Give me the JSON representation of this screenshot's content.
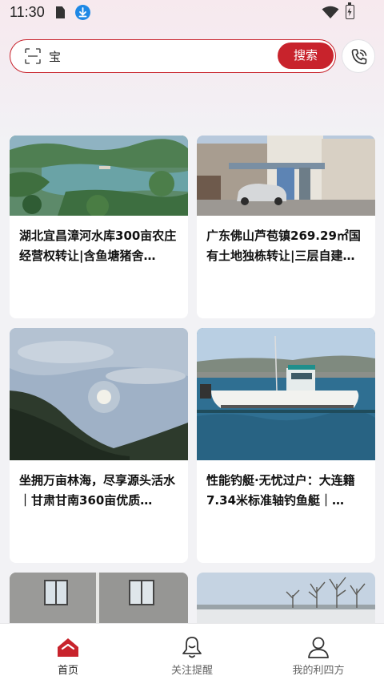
{
  "status_bar": {
    "time": "11:30"
  },
  "search": {
    "query": "宝",
    "button_label": "搜索"
  },
  "colors": {
    "accent": "#c8232c"
  },
  "feed": [
    {
      "title": "湖北宜昌漳河水库300亩农庄经营权转让|含鱼塘猪舍…",
      "image": "lake-reservoir-aerial"
    },
    {
      "title": "广东佛山芦苞镇269.29㎡国有土地独栋转让|三层自建…",
      "image": "street-house-with-car"
    },
    {
      "title": "坐拥万亩林海，尽享源头活水｜甘肃甘南360亩优质…",
      "image": "forest-hills-sunset"
    },
    {
      "title": "性能钓艇·无忧过户：大连籍7.34米标准轴钓鱼艇｜…",
      "image": "fishing-boat-harbor"
    },
    {
      "title": "",
      "image": "empty-room-interior"
    },
    {
      "title": "",
      "image": "winter-field-trees"
    }
  ],
  "bottom_nav": [
    {
      "label": "首页",
      "icon": "home-icon",
      "active": true
    },
    {
      "label": "关注提醒",
      "icon": "bell-icon",
      "active": false
    },
    {
      "label": "我的利四方",
      "icon": "user-icon",
      "active": false
    }
  ]
}
